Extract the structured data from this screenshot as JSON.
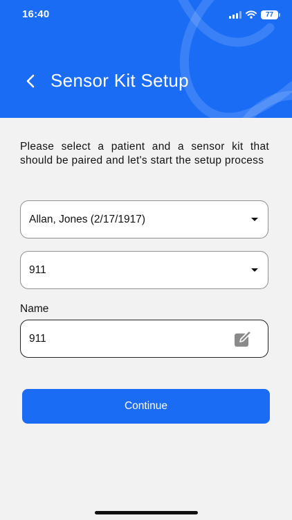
{
  "status_bar": {
    "time": "16:40",
    "battery": "77",
    "icons": [
      "signal-icon",
      "wifi-icon",
      "battery-icon"
    ]
  },
  "header": {
    "back_icon": "chevron-left-icon",
    "title": "Sensor Kit Setup"
  },
  "instructions": "Please select a patient and a sensor kit that should be paired and let's start the setup process",
  "patient_select": {
    "value": "Allan, Jones (2/17/1917)"
  },
  "sensor_kit_select": {
    "value": "911"
  },
  "name_field": {
    "label": "Name",
    "value": "911",
    "icon": "edit-icon"
  },
  "continue_button": {
    "label": "Continue"
  },
  "colors": {
    "primary": "#1a6cf5",
    "background": "#f2f2f2",
    "text": "#111111"
  }
}
